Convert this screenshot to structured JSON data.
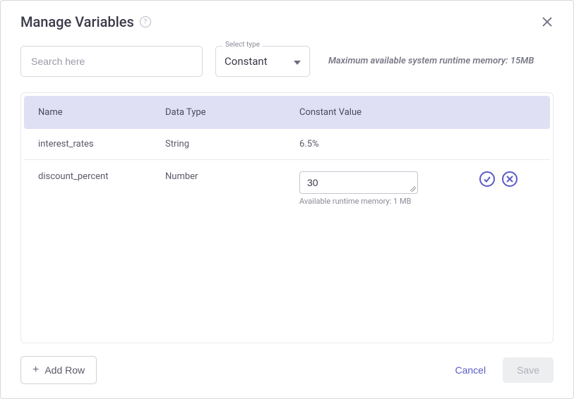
{
  "title": "Manage Variables",
  "search_placeholder": "Search here",
  "select": {
    "label": "Select type",
    "value": "Constant"
  },
  "memory_banner": "Maximum available system runtime memory: 15MB",
  "columns": {
    "name": "Name",
    "data_type": "Data Type",
    "constant_value": "Constant Value"
  },
  "rows": [
    {
      "name": "interest_rates",
      "type": "String",
      "value": "6.5%"
    },
    {
      "name": "discount_percent",
      "type": "Number",
      "value": "30"
    }
  ],
  "editing_hint": "Available runtime memory: 1 MB",
  "add_row_label": "Add Row",
  "cancel_label": "Cancel",
  "save_label": "Save"
}
